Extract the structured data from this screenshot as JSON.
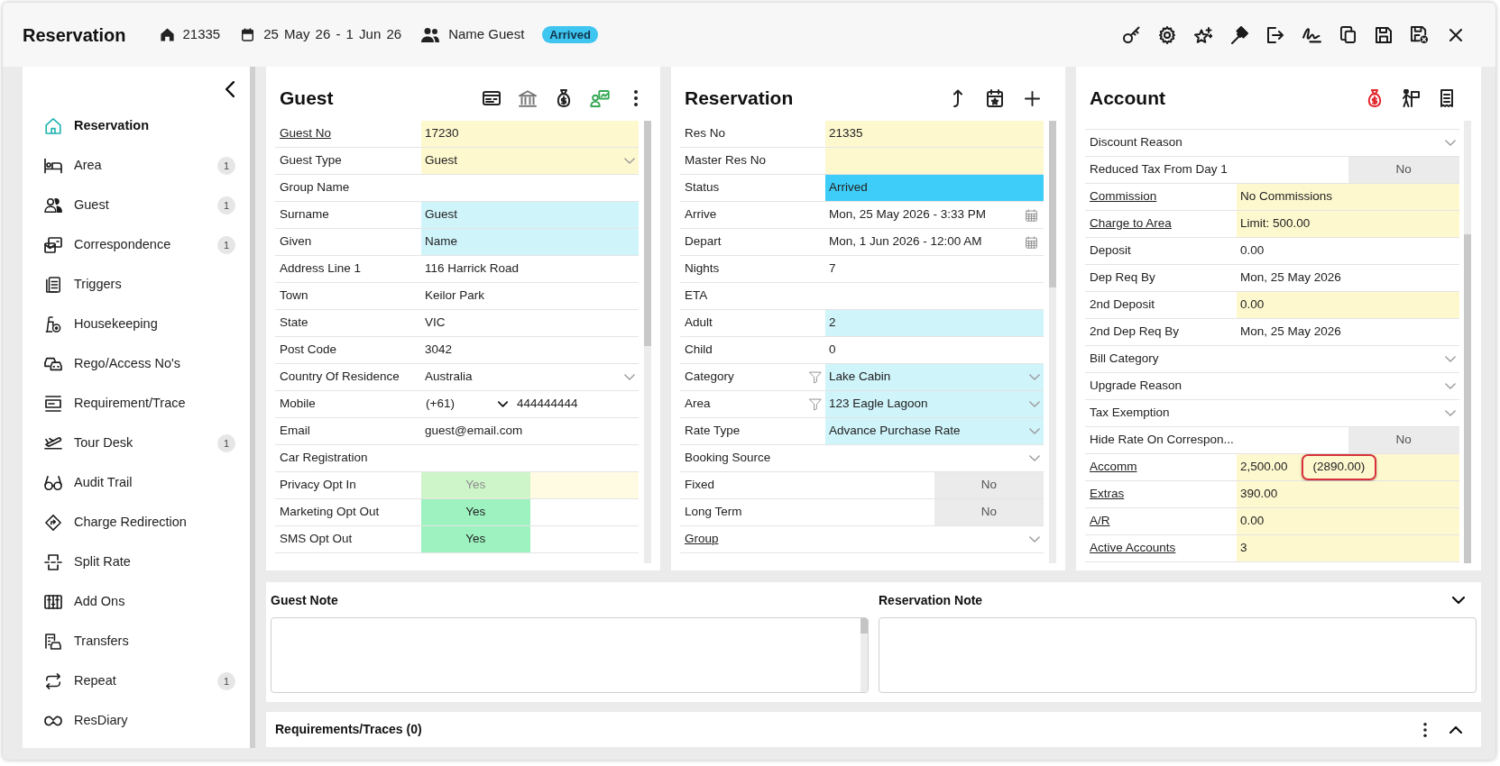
{
  "header": {
    "title": "Reservation",
    "reservation_number": "21335",
    "dates": "25 May 26 - 1 Jun 26",
    "guest_name": "Name Guest",
    "status": "Arrived"
  },
  "sidebar": {
    "items": [
      {
        "label": "Reservation",
        "selected": true
      },
      {
        "label": "Area",
        "badge": "1",
        "selected": false
      },
      {
        "label": "Guest",
        "badge": "1",
        "selected": false
      },
      {
        "label": "Correspondence",
        "badge": "1",
        "selected": false
      },
      {
        "label": "Triggers",
        "selected": false
      },
      {
        "label": "Housekeeping",
        "selected": false
      },
      {
        "label": "Rego/Access No's",
        "selected": false
      },
      {
        "label": "Requirement/Trace",
        "selected": false
      },
      {
        "label": "Tour Desk",
        "badge": "1",
        "selected": false
      },
      {
        "label": "Audit Trail",
        "selected": false
      },
      {
        "label": "Charge Redirection",
        "selected": false
      },
      {
        "label": "Split Rate",
        "selected": false
      },
      {
        "label": "Add Ons",
        "selected": false
      },
      {
        "label": "Transfers",
        "selected": false
      },
      {
        "label": "Repeat",
        "badge": "1",
        "selected": false
      },
      {
        "label": "ResDiary",
        "selected": false
      }
    ]
  },
  "guest": {
    "title": "Guest",
    "rows": [
      {
        "kind": "text",
        "label": "Guest No",
        "link": true,
        "value": "17230",
        "color": "#fef8cf"
      },
      {
        "kind": "select",
        "label": "Guest Type",
        "link": false,
        "value": "Guest",
        "color": "#fef8cf"
      },
      {
        "kind": "text",
        "label": "Group Name",
        "link": false
      },
      {
        "kind": "text",
        "label": "Surname",
        "link": false,
        "value": "Guest",
        "color": "#cff4fa"
      },
      {
        "kind": "text",
        "label": "Given",
        "link": false,
        "value": "Name",
        "color": "#cff4fa"
      },
      {
        "kind": "text",
        "label": "Address Line 1",
        "link": false,
        "value": "116 Harrick Road"
      },
      {
        "kind": "text",
        "label": "Town",
        "link": false,
        "value": "Keilor Park"
      },
      {
        "kind": "text",
        "label": "State",
        "link": false,
        "value": "VIC"
      },
      {
        "kind": "text",
        "label": "Post Code",
        "link": false,
        "value": "3042"
      },
      {
        "kind": "select",
        "label": "Country Of Residence",
        "link": false,
        "value": "Australia"
      },
      {
        "kind": "phone",
        "label": "Mobile",
        "link": false,
        "country_code": "(+61)",
        "value": "444444444"
      },
      {
        "kind": "text",
        "label": "Email",
        "link": false,
        "value": "guest@email.com"
      },
      {
        "kind": "text",
        "label": "Car Registration",
        "link": false
      },
      {
        "kind": "toggle",
        "label": "Privacy Opt In",
        "link": false,
        "value": "Yes",
        "on": true,
        "disabled": true
      },
      {
        "kind": "toggle",
        "label": "Marketing Opt Out",
        "link": false,
        "value": "Yes",
        "on": true,
        "disabled": false
      },
      {
        "kind": "toggle",
        "label": "SMS Opt Out",
        "link": false,
        "value": "Yes",
        "on": true,
        "disabled": false
      }
    ]
  },
  "reservation": {
    "title": "Reservation",
    "rows": [
      {
        "kind": "text",
        "label": "Res No",
        "link": false,
        "filter": false,
        "value": "21335",
        "color": "#fef8cf"
      },
      {
        "kind": "text",
        "label": "Master Res No",
        "link": false,
        "filter": false,
        "color": "#fef8cf"
      },
      {
        "kind": "text",
        "label": "Status",
        "link": false,
        "filter": false,
        "value": "Arrived",
        "color": "#3dcdf8"
      },
      {
        "kind": "date",
        "label": "Arrive",
        "link": false,
        "filter": false,
        "value": "Mon, 25 May 2026 - 3:33 PM"
      },
      {
        "kind": "date",
        "label": "Depart",
        "link": false,
        "filter": false,
        "value": "Mon, 1 Jun 2026 - 12:00 AM"
      },
      {
        "kind": "text",
        "label": "Nights",
        "link": false,
        "filter": false,
        "value": "7"
      },
      {
        "kind": "text",
        "label": "ETA",
        "link": false,
        "filter": false
      },
      {
        "kind": "text",
        "label": "Adult",
        "link": false,
        "filter": false,
        "value": "2",
        "color": "#cff4fa"
      },
      {
        "kind": "text",
        "label": "Child",
        "link": false,
        "filter": false,
        "value": "0"
      },
      {
        "kind": "select",
        "label": "Category",
        "link": false,
        "filter": true,
        "value": "Lake Cabin",
        "color": "#cff4fa"
      },
      {
        "kind": "select",
        "label": "Area",
        "link": false,
        "filter": true,
        "value": "123 Eagle Lagoon",
        "color": "#cff4fa"
      },
      {
        "kind": "select",
        "label": "Rate Type",
        "link": false,
        "filter": false,
        "value": "Advance Purchase Rate",
        "color": "#cff4fa"
      },
      {
        "kind": "select",
        "label": "Booking Source",
        "link": false,
        "filter": false
      },
      {
        "kind": "toggle",
        "label": "Fixed",
        "link": false,
        "filter": false,
        "value": "No",
        "on": false,
        "disabled": false
      },
      {
        "kind": "toggle",
        "label": "Long Term",
        "link": false,
        "filter": false,
        "value": "No",
        "on": false,
        "disabled": false
      },
      {
        "kind": "select",
        "label": "Group",
        "link": true,
        "filter": false
      }
    ]
  },
  "account": {
    "title": "Account",
    "rows": [
      {
        "kind": "select",
        "label": "Discount Reason",
        "link": false
      },
      {
        "kind": "toggle",
        "label": "Reduced Tax From Day 1",
        "link": false,
        "value": "No",
        "on": false,
        "disabled": false
      },
      {
        "kind": "text",
        "label": "Commission",
        "link": true,
        "value": "No Commissions",
        "color": "#fef8cf"
      },
      {
        "kind": "text",
        "label": "Charge to Area",
        "link": true,
        "value": "Limit: 500.00",
        "color": "#fef8cf"
      },
      {
        "kind": "text",
        "label": "Deposit",
        "link": false,
        "value": "0.00"
      },
      {
        "kind": "text",
        "label": "Dep Req By",
        "link": false,
        "value": "Mon, 25 May 2026"
      },
      {
        "kind": "text",
        "label": "2nd Deposit",
        "link": false,
        "value": "0.00",
        "color": "#fef8cf"
      },
      {
        "kind": "text",
        "label": "2nd Dep Req By",
        "link": false,
        "value": "Mon, 25 May 2026"
      },
      {
        "kind": "select",
        "label": "Bill Category",
        "link": false
      },
      {
        "kind": "select",
        "label": "Upgrade Reason",
        "link": false
      },
      {
        "kind": "select",
        "label": "Tax Exemption",
        "link": false
      },
      {
        "kind": "toggle",
        "label": "Hide Rate On Correspon...",
        "link": false,
        "value": "No",
        "on": false,
        "disabled": false
      },
      {
        "kind": "text",
        "label": "Accomm",
        "link": true,
        "value": "2,500.00",
        "color": "#fef8cf",
        "extra": {
          "text": "(2890.00)",
          "highlighted": true
        }
      },
      {
        "kind": "text",
        "label": "Extras",
        "link": true,
        "value": "390.00",
        "color": "#fef8cf"
      },
      {
        "kind": "text",
        "label": "A/R",
        "link": true,
        "value": "0.00",
        "color": "#fef8cf"
      },
      {
        "kind": "text",
        "label": "Active Accounts",
        "link": true,
        "value": "3",
        "color": "#fef8cf"
      }
    ]
  },
  "notes": {
    "expanded": true,
    "fields": [
      {
        "label": "Guest Note"
      },
      {
        "label": "Reservation Note"
      }
    ]
  },
  "requirements": {
    "title": "Requirements/Traces (0)",
    "expanded": false
  }
}
